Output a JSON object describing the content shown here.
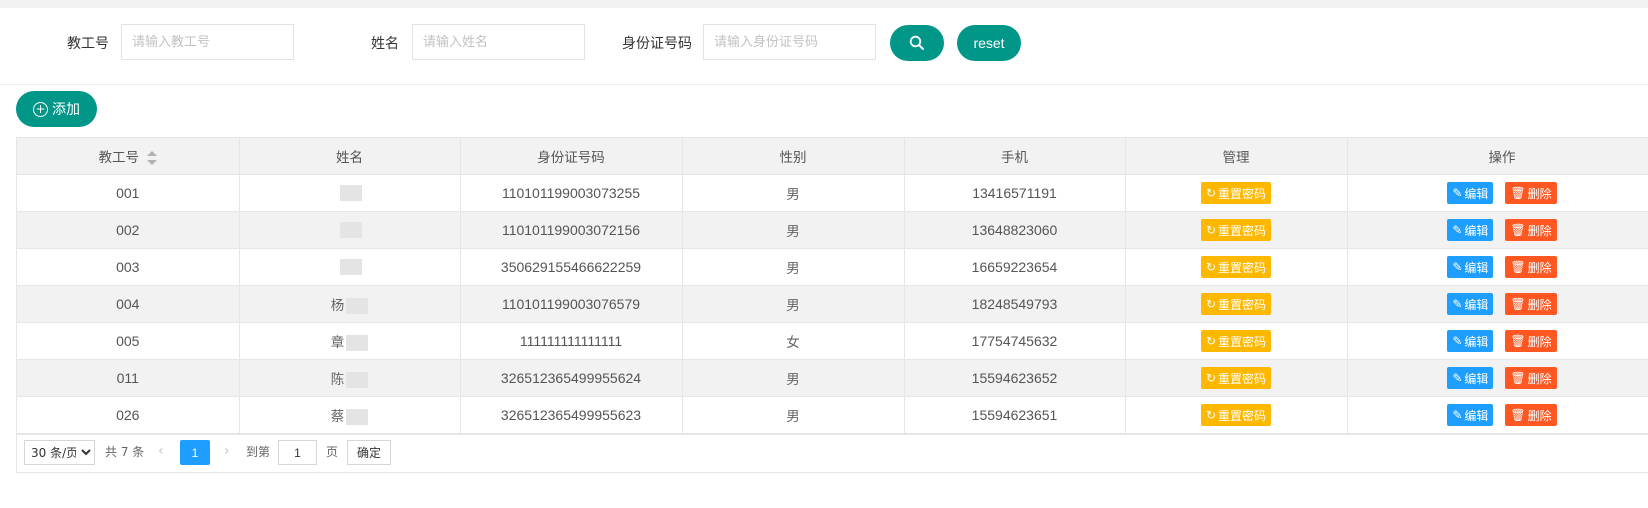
{
  "search": {
    "teacher_no_label": "教工号",
    "teacher_no_placeholder": "请输入教工号",
    "name_label": "姓名",
    "name_placeholder": "请输入姓名",
    "id_label": "身份证号码",
    "id_placeholder": "请输入身份证号码",
    "search_icon": "search-icon",
    "reset_label": "reset"
  },
  "toolbar": {
    "add_label": "添加",
    "add_icon": "plus-circle-icon"
  },
  "table": {
    "columns": [
      "教工号",
      "姓名",
      "身份证号码",
      "性别",
      "手机",
      "管理",
      "操作"
    ],
    "actions": {
      "reset_password": "重置密码",
      "edit": "编辑",
      "delete": "删除"
    },
    "rows": [
      {
        "no": "001",
        "name": "",
        "id": "110101199003073255",
        "gender": "男",
        "phone": "13416571191"
      },
      {
        "no": "002",
        "name": "",
        "id": "110101199003072156",
        "gender": "男",
        "phone": "13648823060"
      },
      {
        "no": "003",
        "name": "",
        "id": "350629155466622259",
        "gender": "男",
        "phone": "16659223654"
      },
      {
        "no": "004",
        "name": "杨",
        "id": "110101199003076579",
        "gender": "男",
        "phone": "18248549793"
      },
      {
        "no": "005",
        "name": "章",
        "id": "111111111111111",
        "gender": "女",
        "phone": "17754745632"
      },
      {
        "no": "011",
        "name": "陈",
        "id": "326512365499955624",
        "gender": "男",
        "phone": "15594623652"
      },
      {
        "no": "026",
        "name": "蔡",
        "id": "326512365499955623",
        "gender": "男",
        "phone": "15594623651"
      }
    ]
  },
  "pager": {
    "page_size": "30 条/页",
    "total": "共 7 条",
    "prev_icon": "chevron-left-icon",
    "current_page": "1",
    "next_icon": "chevron-right-icon",
    "goto_label": "到第",
    "goto_value": "1",
    "page_unit": "页",
    "confirm_label": "确定"
  },
  "colors": {
    "primary": "#009688",
    "warn": "#FFB800",
    "edit": "#1E9FFF",
    "danger": "#FF5722",
    "active_page": "#1E9FFF"
  }
}
